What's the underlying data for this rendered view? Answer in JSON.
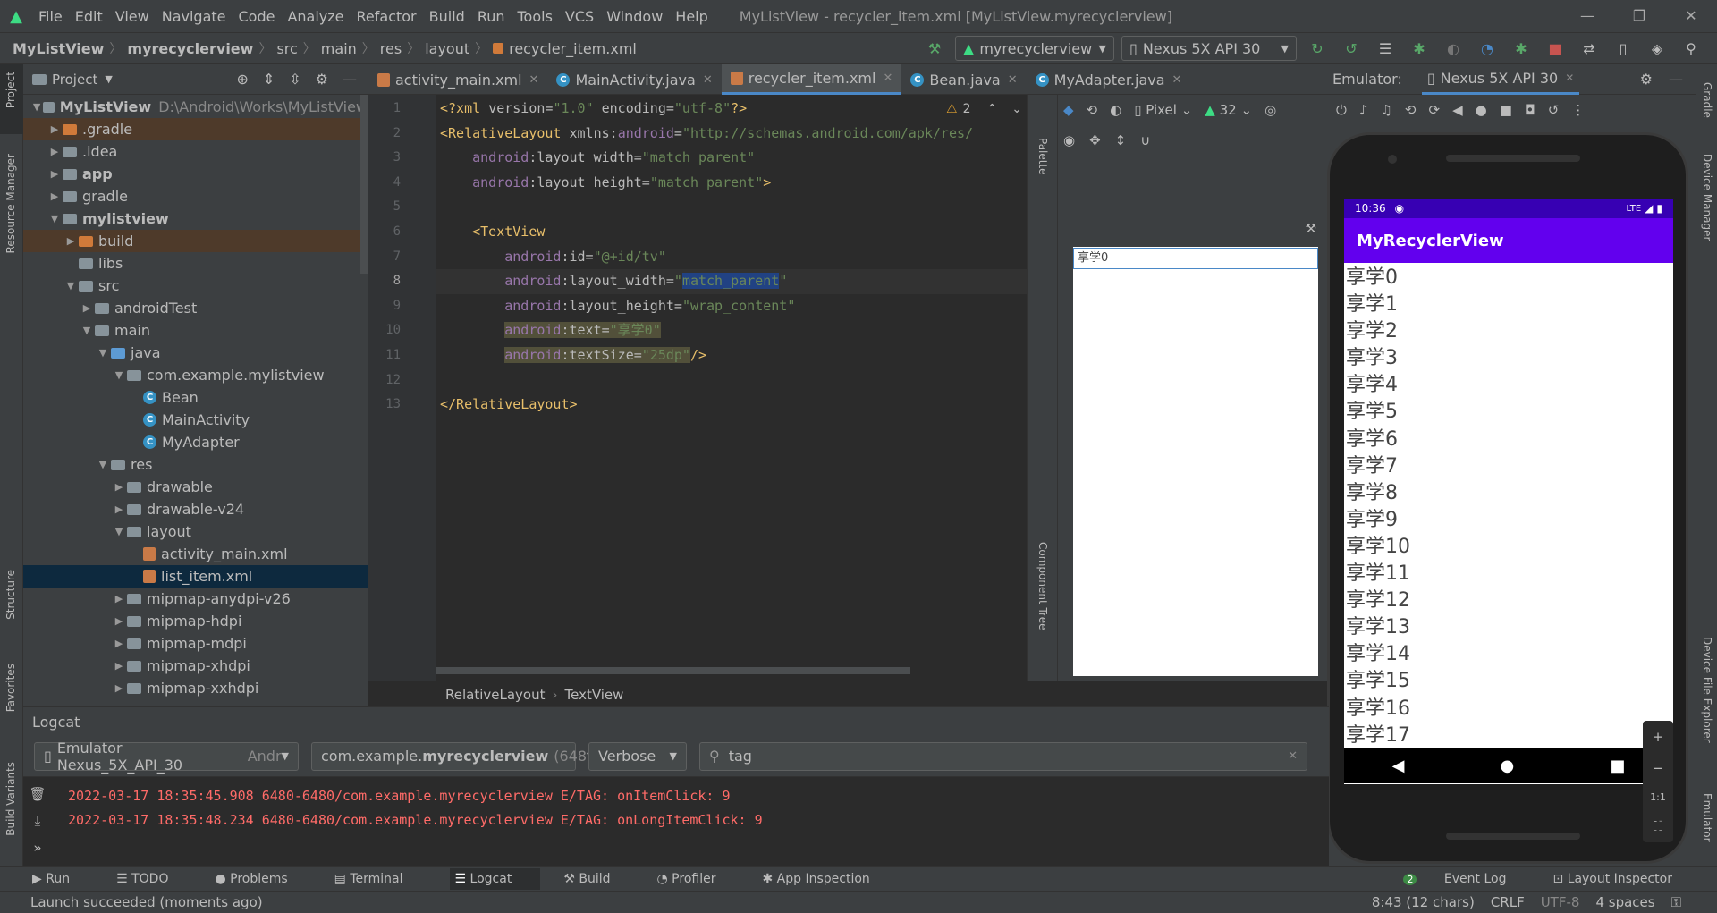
{
  "title_bar": {
    "menus": [
      "File",
      "Edit",
      "View",
      "Navigate",
      "Code",
      "Analyze",
      "Refactor",
      "Build",
      "Run",
      "Tools",
      "VCS",
      "Window",
      "Help"
    ],
    "window_title": "MyListView - recycler_item.xml [MyListView.myrecyclerview]"
  },
  "nav_bar": {
    "crumbs": [
      "MyListView",
      "myrecyclerview",
      "src",
      "main",
      "res",
      "layout",
      "recycler_item.xml"
    ],
    "run_config": "myrecyclerview",
    "device": "Nexus 5X API 30"
  },
  "left_stripe": {
    "project": "Project",
    "resource_manager": "Resource Manager",
    "structure": "Structure",
    "favorites": "Favorites",
    "build_variants": "Build Variants"
  },
  "right_stripe": {
    "gradle": "Gradle",
    "device_manager": "Device Manager",
    "device_file_explorer": "Device File Explorer",
    "emulator": "Emulator"
  },
  "project_panel": {
    "title": "Project",
    "tree": [
      {
        "label": "MyListView",
        "suffix": "D:\\Android\\Works\\MyListView",
        "depth": 0,
        "arrow": "down",
        "icon": "folder-gray",
        "bold": true
      },
      {
        "label": ".gradle",
        "depth": 1,
        "arrow": "right",
        "icon": "folder-orange",
        "hl": true
      },
      {
        "label": ".idea",
        "depth": 1,
        "arrow": "right",
        "icon": "folder-gray"
      },
      {
        "label": "app",
        "depth": 1,
        "arrow": "right",
        "icon": "folder-gray",
        "bold": true
      },
      {
        "label": "gradle",
        "depth": 1,
        "arrow": "right",
        "icon": "folder-gray"
      },
      {
        "label": "mylistview",
        "depth": 1,
        "arrow": "down",
        "icon": "folder-gray",
        "bold": true
      },
      {
        "label": "build",
        "depth": 2,
        "arrow": "right",
        "icon": "folder-orange",
        "hl": true
      },
      {
        "label": "libs",
        "depth": 2,
        "arrow": "",
        "icon": "folder-gray"
      },
      {
        "label": "src",
        "depth": 2,
        "arrow": "down",
        "icon": "folder-gray"
      },
      {
        "label": "androidTest",
        "depth": 3,
        "arrow": "right",
        "icon": "folder-gray"
      },
      {
        "label": "main",
        "depth": 3,
        "arrow": "down",
        "icon": "folder-gray"
      },
      {
        "label": "java",
        "depth": 4,
        "arrow": "down",
        "icon": "folder-blue"
      },
      {
        "label": "com.example.mylistview",
        "depth": 5,
        "arrow": "down",
        "icon": "folder-gray"
      },
      {
        "label": "Bean",
        "depth": 6,
        "arrow": "",
        "icon": "class"
      },
      {
        "label": "MainActivity",
        "depth": 6,
        "arrow": "",
        "icon": "class"
      },
      {
        "label": "MyAdapter",
        "depth": 6,
        "arrow": "",
        "icon": "class"
      },
      {
        "label": "res",
        "depth": 4,
        "arrow": "down",
        "icon": "folder-gray"
      },
      {
        "label": "drawable",
        "depth": 5,
        "arrow": "right",
        "icon": "folder-gray"
      },
      {
        "label": "drawable-v24",
        "depth": 5,
        "arrow": "right",
        "icon": "folder-gray"
      },
      {
        "label": "layout",
        "depth": 5,
        "arrow": "down",
        "icon": "folder-gray"
      },
      {
        "label": "activity_main.xml",
        "depth": 6,
        "arrow": "",
        "icon": "xml"
      },
      {
        "label": "list_item.xml",
        "depth": 6,
        "arrow": "",
        "icon": "xml",
        "sel": true
      },
      {
        "label": "mipmap-anydpi-v26",
        "depth": 5,
        "arrow": "right",
        "icon": "folder-gray"
      },
      {
        "label": "mipmap-hdpi",
        "depth": 5,
        "arrow": "right",
        "icon": "folder-gray"
      },
      {
        "label": "mipmap-mdpi",
        "depth": 5,
        "arrow": "right",
        "icon": "folder-gray"
      },
      {
        "label": "mipmap-xhdpi",
        "depth": 5,
        "arrow": "right",
        "icon": "folder-gray"
      },
      {
        "label": "mipmap-xxhdpi",
        "depth": 5,
        "arrow": "right",
        "icon": "folder-gray"
      }
    ]
  },
  "editor": {
    "tabs": [
      {
        "label": "activity_main.xml",
        "type": "xml"
      },
      {
        "label": "MainActivity.java",
        "type": "class"
      },
      {
        "label": "recycler_item.xml",
        "type": "xml",
        "active": true
      },
      {
        "label": "Bean.java",
        "type": "class"
      },
      {
        "label": "MyAdapter.java",
        "type": "class"
      }
    ],
    "warnings": "2",
    "current_line": 8,
    "breadcrumb": [
      "RelativeLayout",
      "TextView"
    ]
  },
  "design": {
    "palette_label": "Palette",
    "component_tree_label": "Component Tree",
    "device": "Pixel",
    "api": "32",
    "preview_text": "享学0"
  },
  "emulator": {
    "label": "Emulator:",
    "device_tab": "Nexus 5X API 30",
    "time": "10:36",
    "network": "LTE",
    "app_title": "MyRecyclerView",
    "items": [
      "享学0",
      "享学1",
      "享学2",
      "享学3",
      "享学4",
      "享学5",
      "享学6",
      "享学7",
      "享学8",
      "享学9",
      "享学10",
      "享学11",
      "享学12",
      "享学13",
      "享学14",
      "享学15",
      "享学16",
      "享学17"
    ],
    "zoom_label": "1:1"
  },
  "logcat": {
    "title": "Logcat",
    "device_filter": "Emulator Nexus_5X_API_30",
    "device_filter_suffix": "Andr",
    "package_prefix": "com.example.",
    "package_bold": "myrecyclerview",
    "package_suffix": "(648",
    "level": "Verbose",
    "search": "tag",
    "lines": [
      "2022-03-17 18:35:45.908 6480-6480/com.example.myrecyclerview E/TAG: onItemClick: 9",
      "2022-03-17 18:35:48.234 6480-6480/com.example.myrecyclerview E/TAG: onLongItemClick: 9"
    ]
  },
  "tool_windows": {
    "left": [
      "Run",
      "TODO",
      "Problems",
      "Terminal",
      "Logcat",
      "Build",
      "Profiler",
      "App Inspection"
    ],
    "active": "Logcat",
    "right": [
      "Event Log",
      "Layout Inspector"
    ],
    "event_count": "2"
  },
  "status": {
    "message": "Launch succeeded (moments ago)",
    "position": "8:43 (12 chars)",
    "line_sep": "CRLF",
    "encoding": "UTF-8",
    "indent": "4 spaces"
  }
}
